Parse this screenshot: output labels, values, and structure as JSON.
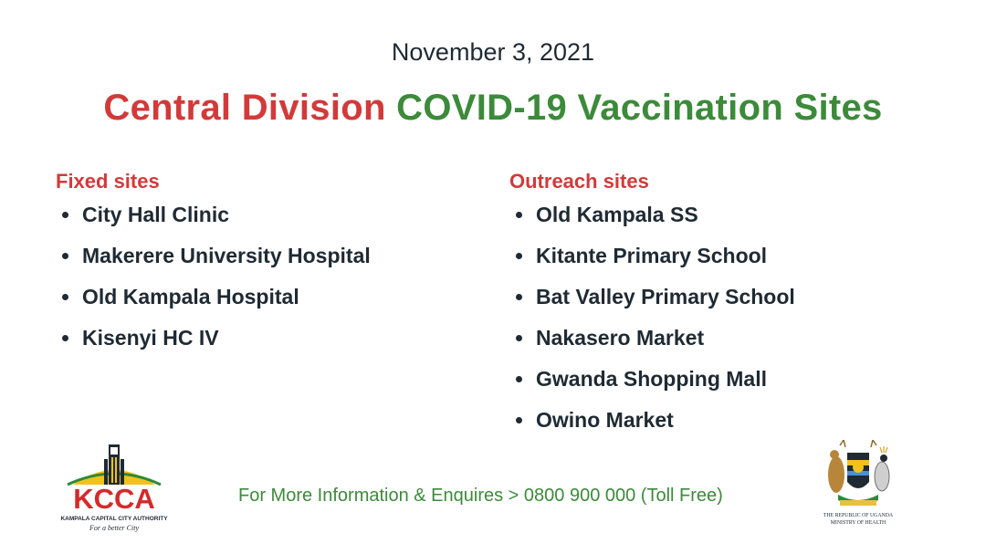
{
  "date": "November 3, 2021",
  "title": {
    "part1": "Central Division",
    "part2": "COVID-19 Vaccination Sites"
  },
  "fixed": {
    "heading": "Fixed sites",
    "items": [
      "City Hall Clinic",
      "Makerere University Hospital",
      "Old Kampala Hospital",
      "Kisenyi HC IV"
    ]
  },
  "outreach": {
    "heading": "Outreach sites",
    "items": [
      "Old Kampala SS",
      "Kitante Primary School",
      "Bat Valley Primary School",
      "Nakasero Market",
      "Gwanda Shopping Mall",
      "Owino Market"
    ]
  },
  "footer": "For More Information & Enquires > 0800 900 000 (Toll Free)",
  "kcca": {
    "name": "KCCA",
    "full": "KAMPALA CAPITAL CITY AUTHORITY",
    "tagline": "For a better City"
  },
  "uganda": {
    "line1": "THE REPUBLIC OF UGANDA",
    "line2": "MINISTRY OF HEALTH"
  },
  "colors": {
    "red": "#d23a3a",
    "green": "#3c8a3a",
    "text": "#1f2a33"
  }
}
